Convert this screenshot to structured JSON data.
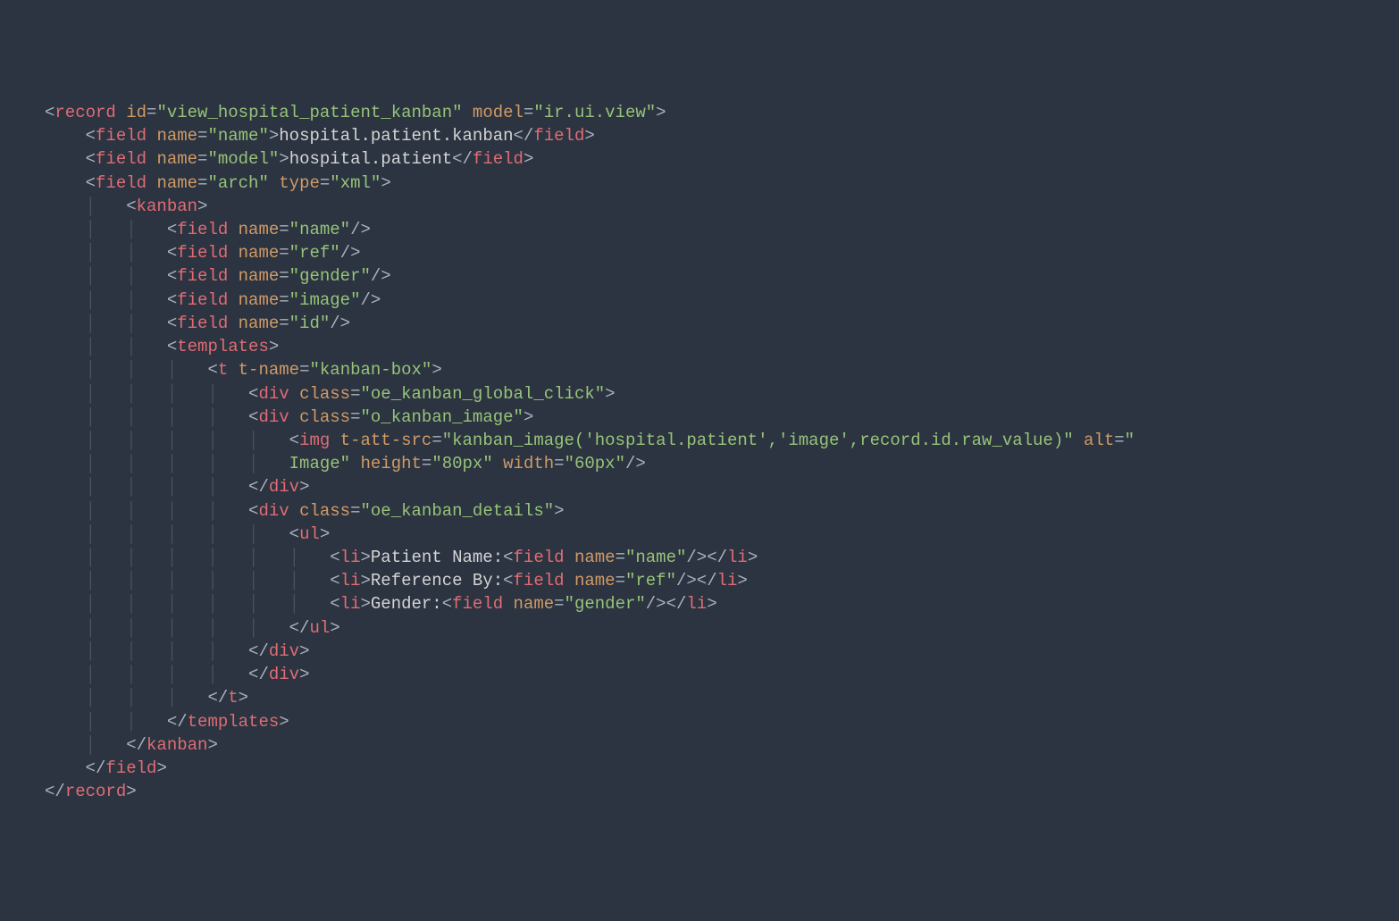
{
  "lines": [
    [
      {
        "t": "<",
        "c": "bracket"
      },
      {
        "t": "record",
        "c": "tag"
      },
      {
        "t": " ",
        "c": "text"
      },
      {
        "t": "id",
        "c": "attr-name"
      },
      {
        "t": "=",
        "c": "bracket"
      },
      {
        "t": "\"view_hospital_patient_kanban\"",
        "c": "attr-val"
      },
      {
        "t": " ",
        "c": "text"
      },
      {
        "t": "model",
        "c": "attr-name"
      },
      {
        "t": "=",
        "c": "bracket"
      },
      {
        "t": "\"ir.ui.view\"",
        "c": "attr-val"
      },
      {
        "t": ">",
        "c": "bracket"
      }
    ],
    [
      {
        "t": "    ",
        "c": "text"
      },
      {
        "t": "<",
        "c": "bracket"
      },
      {
        "t": "field",
        "c": "tag"
      },
      {
        "t": " ",
        "c": "text"
      },
      {
        "t": "name",
        "c": "attr-name"
      },
      {
        "t": "=",
        "c": "bracket"
      },
      {
        "t": "\"name\"",
        "c": "attr-val"
      },
      {
        "t": ">",
        "c": "bracket"
      },
      {
        "t": "hospital.patient.kanban",
        "c": "text"
      },
      {
        "t": "</",
        "c": "bracket"
      },
      {
        "t": "field",
        "c": "tag"
      },
      {
        "t": ">",
        "c": "bracket"
      }
    ],
    [
      {
        "t": "    ",
        "c": "text"
      },
      {
        "t": "<",
        "c": "bracket"
      },
      {
        "t": "field",
        "c": "tag"
      },
      {
        "t": " ",
        "c": "text"
      },
      {
        "t": "name",
        "c": "attr-name"
      },
      {
        "t": "=",
        "c": "bracket"
      },
      {
        "t": "\"model\"",
        "c": "attr-val"
      },
      {
        "t": ">",
        "c": "bracket"
      },
      {
        "t": "hospital.patient",
        "c": "text"
      },
      {
        "t": "</",
        "c": "bracket"
      },
      {
        "t": "field",
        "c": "tag"
      },
      {
        "t": ">",
        "c": "bracket"
      }
    ],
    [
      {
        "t": "    ",
        "c": "text"
      },
      {
        "t": "<",
        "c": "bracket"
      },
      {
        "t": "field",
        "c": "tag"
      },
      {
        "t": " ",
        "c": "text"
      },
      {
        "t": "name",
        "c": "attr-name"
      },
      {
        "t": "=",
        "c": "bracket"
      },
      {
        "t": "\"arch\"",
        "c": "attr-val"
      },
      {
        "t": " ",
        "c": "text"
      },
      {
        "t": "type",
        "c": "attr-name"
      },
      {
        "t": "=",
        "c": "bracket"
      },
      {
        "t": "\"xml\"",
        "c": "attr-val"
      },
      {
        "t": ">",
        "c": "bracket"
      }
    ],
    [
      {
        "t": "    ",
        "c": "text"
      },
      {
        "t": "│   ",
        "c": "guide"
      },
      {
        "t": "<",
        "c": "bracket"
      },
      {
        "t": "kanban",
        "c": "tag"
      },
      {
        "t": ">",
        "c": "bracket"
      }
    ],
    [
      {
        "t": "    ",
        "c": "text"
      },
      {
        "t": "│   │   ",
        "c": "guide"
      },
      {
        "t": "<",
        "c": "bracket"
      },
      {
        "t": "field",
        "c": "tag"
      },
      {
        "t": " ",
        "c": "text"
      },
      {
        "t": "name",
        "c": "attr-name"
      },
      {
        "t": "=",
        "c": "bracket"
      },
      {
        "t": "\"name\"",
        "c": "attr-val"
      },
      {
        "t": "/>",
        "c": "bracket"
      }
    ],
    [
      {
        "t": "    ",
        "c": "text"
      },
      {
        "t": "│   │   ",
        "c": "guide"
      },
      {
        "t": "<",
        "c": "bracket"
      },
      {
        "t": "field",
        "c": "tag"
      },
      {
        "t": " ",
        "c": "text"
      },
      {
        "t": "name",
        "c": "attr-name"
      },
      {
        "t": "=",
        "c": "bracket"
      },
      {
        "t": "\"ref\"",
        "c": "attr-val"
      },
      {
        "t": "/>",
        "c": "bracket"
      }
    ],
    [
      {
        "t": "    ",
        "c": "text"
      },
      {
        "t": "│   │   ",
        "c": "guide"
      },
      {
        "t": "<",
        "c": "bracket"
      },
      {
        "t": "field",
        "c": "tag"
      },
      {
        "t": " ",
        "c": "text"
      },
      {
        "t": "name",
        "c": "attr-name"
      },
      {
        "t": "=",
        "c": "bracket"
      },
      {
        "t": "\"gender\"",
        "c": "attr-val"
      },
      {
        "t": "/>",
        "c": "bracket"
      }
    ],
    [
      {
        "t": "    ",
        "c": "text"
      },
      {
        "t": "│   │   ",
        "c": "guide"
      },
      {
        "t": "<",
        "c": "bracket"
      },
      {
        "t": "field",
        "c": "tag"
      },
      {
        "t": " ",
        "c": "text"
      },
      {
        "t": "name",
        "c": "attr-name"
      },
      {
        "t": "=",
        "c": "bracket"
      },
      {
        "t": "\"image\"",
        "c": "attr-val"
      },
      {
        "t": "/>",
        "c": "bracket"
      }
    ],
    [
      {
        "t": "    ",
        "c": "text"
      },
      {
        "t": "│   │   ",
        "c": "guide"
      },
      {
        "t": "<",
        "c": "bracket"
      },
      {
        "t": "field",
        "c": "tag"
      },
      {
        "t": " ",
        "c": "text"
      },
      {
        "t": "name",
        "c": "attr-name"
      },
      {
        "t": "=",
        "c": "bracket"
      },
      {
        "t": "\"id\"",
        "c": "attr-val"
      },
      {
        "t": "/>",
        "c": "bracket"
      }
    ],
    [
      {
        "t": "    ",
        "c": "text"
      },
      {
        "t": "│   │   ",
        "c": "guide"
      },
      {
        "t": "<",
        "c": "bracket"
      },
      {
        "t": "templates",
        "c": "tag"
      },
      {
        "t": ">",
        "c": "bracket"
      }
    ],
    [
      {
        "t": "    ",
        "c": "text"
      },
      {
        "t": "│   │   │   ",
        "c": "guide"
      },
      {
        "t": "<",
        "c": "bracket"
      },
      {
        "t": "t",
        "c": "tag"
      },
      {
        "t": " ",
        "c": "text"
      },
      {
        "t": "t-name",
        "c": "attr-name"
      },
      {
        "t": "=",
        "c": "bracket"
      },
      {
        "t": "\"kanban-box\"",
        "c": "attr-val"
      },
      {
        "t": ">",
        "c": "bracket"
      }
    ],
    [
      {
        "t": "    ",
        "c": "text"
      },
      {
        "t": "│   │   │   │   ",
        "c": "guide"
      },
      {
        "t": "<",
        "c": "bracket"
      },
      {
        "t": "div",
        "c": "tag"
      },
      {
        "t": " ",
        "c": "text"
      },
      {
        "t": "class",
        "c": "attr-name"
      },
      {
        "t": "=",
        "c": "bracket"
      },
      {
        "t": "\"oe_kanban_global_click\"",
        "c": "attr-val"
      },
      {
        "t": ">",
        "c": "bracket"
      }
    ],
    [
      {
        "t": "    ",
        "c": "text"
      },
      {
        "t": "│   │   │   │   ",
        "c": "guide"
      },
      {
        "t": "<",
        "c": "bracket"
      },
      {
        "t": "div",
        "c": "tag"
      },
      {
        "t": " ",
        "c": "text"
      },
      {
        "t": "class",
        "c": "attr-name"
      },
      {
        "t": "=",
        "c": "bracket"
      },
      {
        "t": "\"o_kanban_image\"",
        "c": "attr-val"
      },
      {
        "t": ">",
        "c": "bracket"
      }
    ],
    [
      {
        "t": "    ",
        "c": "text"
      },
      {
        "t": "│   │   │   │   │   ",
        "c": "guide"
      },
      {
        "t": "<",
        "c": "bracket"
      },
      {
        "t": "img",
        "c": "tag"
      },
      {
        "t": " ",
        "c": "text"
      },
      {
        "t": "t-att-src",
        "c": "attr-name"
      },
      {
        "t": "=",
        "c": "bracket"
      },
      {
        "t": "\"kanban_image('hospital.patient','image',record.id.raw_value)\"",
        "c": "attr-val"
      },
      {
        "t": " ",
        "c": "text"
      },
      {
        "t": "alt",
        "c": "attr-name"
      },
      {
        "t": "=",
        "c": "bracket"
      },
      {
        "t": "\"",
        "c": "attr-val"
      }
    ],
    [
      {
        "t": "    ",
        "c": "text"
      },
      {
        "t": "│   │   │   │   │   ",
        "c": "guide"
      },
      {
        "t": "Image\"",
        "c": "attr-val"
      },
      {
        "t": " ",
        "c": "text"
      },
      {
        "t": "height",
        "c": "attr-name"
      },
      {
        "t": "=",
        "c": "bracket"
      },
      {
        "t": "\"80px\"",
        "c": "attr-val"
      },
      {
        "t": " ",
        "c": "text"
      },
      {
        "t": "width",
        "c": "attr-name"
      },
      {
        "t": "=",
        "c": "bracket"
      },
      {
        "t": "\"60px\"",
        "c": "attr-val"
      },
      {
        "t": "/>",
        "c": "bracket"
      }
    ],
    [
      {
        "t": "    ",
        "c": "text"
      },
      {
        "t": "│   │   │   │   ",
        "c": "guide"
      },
      {
        "t": "</",
        "c": "bracket"
      },
      {
        "t": "div",
        "c": "tag"
      },
      {
        "t": ">",
        "c": "bracket"
      }
    ],
    [
      {
        "t": "    ",
        "c": "text"
      },
      {
        "t": "│   │   │   │   ",
        "c": "guide"
      },
      {
        "t": "<",
        "c": "bracket"
      },
      {
        "t": "div",
        "c": "tag"
      },
      {
        "t": " ",
        "c": "text"
      },
      {
        "t": "class",
        "c": "attr-name"
      },
      {
        "t": "=",
        "c": "bracket"
      },
      {
        "t": "\"oe_kanban_details\"",
        "c": "attr-val"
      },
      {
        "t": ">",
        "c": "bracket"
      }
    ],
    [
      {
        "t": "    ",
        "c": "text"
      },
      {
        "t": "│   │   │   │   │   ",
        "c": "guide"
      },
      {
        "t": "<",
        "c": "bracket"
      },
      {
        "t": "ul",
        "c": "tag"
      },
      {
        "t": ">",
        "c": "bracket"
      }
    ],
    [
      {
        "t": "    ",
        "c": "text"
      },
      {
        "t": "│   │   │   │   │   │   ",
        "c": "guide"
      },
      {
        "t": "<",
        "c": "bracket"
      },
      {
        "t": "li",
        "c": "tag"
      },
      {
        "t": ">",
        "c": "bracket"
      },
      {
        "t": "Patient Name:",
        "c": "text"
      },
      {
        "t": "<",
        "c": "bracket"
      },
      {
        "t": "field",
        "c": "tag"
      },
      {
        "t": " ",
        "c": "text"
      },
      {
        "t": "name",
        "c": "attr-name"
      },
      {
        "t": "=",
        "c": "bracket"
      },
      {
        "t": "\"name\"",
        "c": "attr-val"
      },
      {
        "t": "/></",
        "c": "bracket"
      },
      {
        "t": "li",
        "c": "tag"
      },
      {
        "t": ">",
        "c": "bracket"
      }
    ],
    [
      {
        "t": "    ",
        "c": "text"
      },
      {
        "t": "│   │   │   │   │   │   ",
        "c": "guide"
      },
      {
        "t": "<",
        "c": "bracket"
      },
      {
        "t": "li",
        "c": "tag"
      },
      {
        "t": ">",
        "c": "bracket"
      },
      {
        "t": "Reference By:",
        "c": "text"
      },
      {
        "t": "<",
        "c": "bracket"
      },
      {
        "t": "field",
        "c": "tag"
      },
      {
        "t": " ",
        "c": "text"
      },
      {
        "t": "name",
        "c": "attr-name"
      },
      {
        "t": "=",
        "c": "bracket"
      },
      {
        "t": "\"ref\"",
        "c": "attr-val"
      },
      {
        "t": "/></",
        "c": "bracket"
      },
      {
        "t": "li",
        "c": "tag"
      },
      {
        "t": ">",
        "c": "bracket"
      }
    ],
    [
      {
        "t": "    ",
        "c": "text"
      },
      {
        "t": "│   │   │   │   │   │   ",
        "c": "guide"
      },
      {
        "t": "<",
        "c": "bracket"
      },
      {
        "t": "li",
        "c": "tag"
      },
      {
        "t": ">",
        "c": "bracket"
      },
      {
        "t": "Gender:",
        "c": "text"
      },
      {
        "t": "<",
        "c": "bracket"
      },
      {
        "t": "field",
        "c": "tag"
      },
      {
        "t": " ",
        "c": "text"
      },
      {
        "t": "name",
        "c": "attr-name"
      },
      {
        "t": "=",
        "c": "bracket"
      },
      {
        "t": "\"gender\"",
        "c": "attr-val"
      },
      {
        "t": "/></",
        "c": "bracket"
      },
      {
        "t": "li",
        "c": "tag"
      },
      {
        "t": ">",
        "c": "bracket"
      }
    ],
    [
      {
        "t": "    ",
        "c": "text"
      },
      {
        "t": "│   │   │   │   │   ",
        "c": "guide"
      },
      {
        "t": "</",
        "c": "bracket"
      },
      {
        "t": "ul",
        "c": "tag"
      },
      {
        "t": ">",
        "c": "bracket"
      }
    ],
    [
      {
        "t": "    ",
        "c": "text"
      },
      {
        "t": "│   │   │   │   ",
        "c": "guide"
      },
      {
        "t": "</",
        "c": "bracket"
      },
      {
        "t": "div",
        "c": "tag"
      },
      {
        "t": ">",
        "c": "bracket"
      }
    ],
    [
      {
        "t": "    ",
        "c": "text"
      },
      {
        "t": "│   │   │   │   ",
        "c": "guide"
      },
      {
        "t": "</",
        "c": "bracket"
      },
      {
        "t": "div",
        "c": "tag"
      },
      {
        "t": ">",
        "c": "bracket"
      }
    ],
    [
      {
        "t": "    ",
        "c": "text"
      },
      {
        "t": "│   │   │   ",
        "c": "guide"
      },
      {
        "t": "</",
        "c": "bracket"
      },
      {
        "t": "t",
        "c": "tag"
      },
      {
        "t": ">",
        "c": "bracket"
      }
    ],
    [
      {
        "t": "    ",
        "c": "text"
      },
      {
        "t": "│   │   ",
        "c": "guide"
      },
      {
        "t": "</",
        "c": "bracket"
      },
      {
        "t": "templates",
        "c": "tag"
      },
      {
        "t": ">",
        "c": "bracket"
      }
    ],
    [
      {
        "t": "    ",
        "c": "text"
      },
      {
        "t": "│   ",
        "c": "guide"
      },
      {
        "t": "</",
        "c": "bracket"
      },
      {
        "t": "kanban",
        "c": "tag"
      },
      {
        "t": ">",
        "c": "bracket"
      }
    ],
    [
      {
        "t": "    ",
        "c": "text"
      },
      {
        "t": "</",
        "c": "bracket"
      },
      {
        "t": "field",
        "c": "tag"
      },
      {
        "t": ">",
        "c": "bracket"
      }
    ],
    [
      {
        "t": "</",
        "c": "bracket"
      },
      {
        "t": "record",
        "c": "tag"
      },
      {
        "t": ">",
        "c": "bracket"
      }
    ]
  ]
}
